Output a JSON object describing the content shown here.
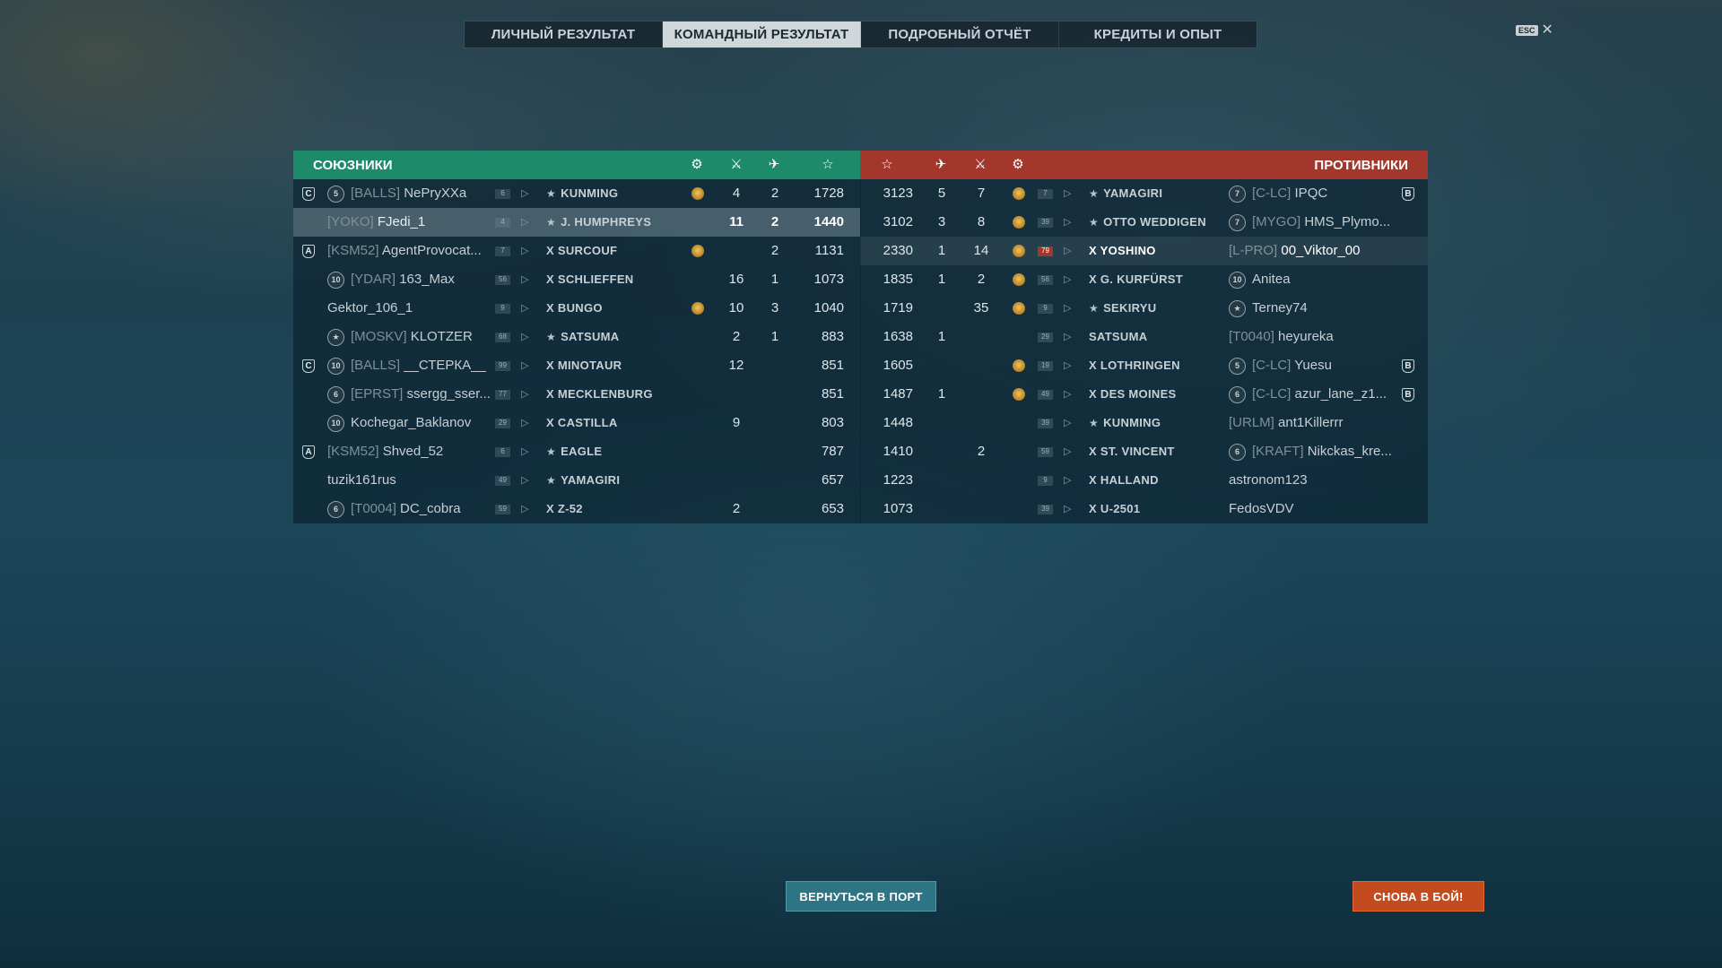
{
  "tabs": [
    {
      "label": "ЛИЧНЫЙ РЕЗУЛЬТАТ",
      "active": false
    },
    {
      "label": "КОМАНДНЫЙ РЕЗУЛЬТАТ",
      "active": true
    },
    {
      "label": "ПОДРОБНЫЙ ОТЧЁТ",
      "active": false
    },
    {
      "label": "КРЕДИТЫ И ОПЫТ",
      "active": false
    }
  ],
  "esc_label": "ESC",
  "close_glyph": "✕",
  "allies": {
    "title": "СОЮЗНИКИ",
    "color": "#1d8a6a",
    "rows": [
      {
        "division": "C",
        "rank": "5",
        "clan": "[BALLS]",
        "name": "NePryXXa",
        "tier": "6",
        "ship_mark": "★",
        "ship": "KUNMING",
        "medal": true,
        "frags": "4",
        "planes": "2",
        "xp": "1728"
      },
      {
        "division": "",
        "rank": "",
        "clan": "[YOKO]",
        "name": "FJedi_1",
        "tier": "4",
        "ship_mark": "★",
        "ship": "J. HUMPHREYS",
        "medal": false,
        "frags": "11",
        "planes": "2",
        "xp": "1440",
        "self": true
      },
      {
        "division": "A",
        "rank": "",
        "clan": "[KSM52]",
        "name": "AgentProvocat...",
        "tier": "7",
        "ship_mark": "",
        "ship": "X SURCOUF",
        "medal": true,
        "frags": "",
        "planes": "2",
        "xp": "1131"
      },
      {
        "division": "",
        "rank": "10",
        "clan": "[YDAR]",
        "name": "163_Max",
        "tier": "56",
        "ship_mark": "",
        "ship": "X SCHLIEFFEN",
        "medal": false,
        "frags": "16",
        "planes": "1",
        "xp": "1073"
      },
      {
        "division": "",
        "rank": "",
        "clan": "",
        "name": "Gektor_106_1",
        "tier": "9",
        "ship_mark": "",
        "ship": "X BUNGO",
        "medal": true,
        "frags": "10",
        "planes": "3",
        "xp": "1040"
      },
      {
        "division": "",
        "rank": "★",
        "clan": "[MOSKV]",
        "name": "KLOTZER",
        "tier": "68",
        "ship_mark": "★",
        "ship": "SATSUMA",
        "medal": false,
        "frags": "2",
        "planes": "1",
        "xp": "883"
      },
      {
        "division": "C",
        "rank": "10",
        "clan": "[BALLS]",
        "name": "__СТЕРКА__",
        "tier": "99",
        "ship_mark": "",
        "ship": "X MINOTAUR",
        "medal": false,
        "frags": "12",
        "planes": "",
        "xp": "851"
      },
      {
        "division": "",
        "rank": "6",
        "clan": "[EPRST]",
        "name": "ssergg_sser...",
        "tier": "77",
        "ship_mark": "",
        "ship": "X MECKLENBURG",
        "medal": false,
        "frags": "",
        "planes": "",
        "xp": "851"
      },
      {
        "division": "",
        "rank": "10",
        "clan": "",
        "name": "Kochegar_Baklanov",
        "tier": "29",
        "ship_mark": "",
        "ship": "X CASTILLA",
        "medal": false,
        "frags": "9",
        "planes": "",
        "xp": "803"
      },
      {
        "division": "A",
        "rank": "",
        "clan": "[KSM52]",
        "name": "Shved_52",
        "tier": "6",
        "ship_mark": "★",
        "ship": "EAGLE",
        "medal": false,
        "frags": "",
        "planes": "",
        "xp": "787"
      },
      {
        "division": "",
        "rank": "",
        "clan": "",
        "name": "tuzik161rus",
        "tier": "49",
        "ship_mark": "★",
        "ship": "YAMAGIRI",
        "medal": false,
        "frags": "",
        "planes": "",
        "xp": "657"
      },
      {
        "division": "",
        "rank": "6",
        "clan": "[T0004]",
        "name": "DC_cobra",
        "tier": "59",
        "ship_mark": "",
        "ship": "X Z-52",
        "medal": false,
        "frags": "2",
        "planes": "",
        "xp": "653"
      }
    ]
  },
  "enemies": {
    "title": "ПРОТИВНИКИ",
    "color": "#a3372b",
    "rows": [
      {
        "xp": "3123",
        "planes": "5",
        "frags": "7",
        "medal": true,
        "tier": "7",
        "ship_mark": "★",
        "ship": "YAMAGIRI",
        "rank": "7",
        "clan": "[C-LC]",
        "name": "IPQC",
        "division": "B"
      },
      {
        "xp": "3102",
        "planes": "3",
        "frags": "8",
        "medal": true,
        "tier": "39",
        "ship_mark": "★",
        "ship": "OTTO WEDDIGEN",
        "rank": "7",
        "clan": "[MYGO]",
        "name": "HMS_Plymo...",
        "division": ""
      },
      {
        "xp": "2330",
        "planes": "1",
        "frags": "14",
        "medal": true,
        "tier": "79",
        "ship_mark": "",
        "ship": "X YOSHINO",
        "rank": "",
        "clan": "[L-PRO]",
        "name": "00_Viktor_00",
        "division": "",
        "highlight": true
      },
      {
        "xp": "1835",
        "planes": "1",
        "frags": "2",
        "medal": true,
        "tier": "56",
        "ship_mark": "",
        "ship": "X G. KURFÜRST",
        "rank": "10",
        "clan": "",
        "name": "Anitea",
        "division": ""
      },
      {
        "xp": "1719",
        "planes": "",
        "frags": "35",
        "medal": true,
        "tier": "9",
        "ship_mark": "★",
        "ship": "SEKIRYU",
        "rank": "★",
        "clan": "",
        "name": "Terney74",
        "division": ""
      },
      {
        "xp": "1638",
        "planes": "1",
        "frags": "",
        "medal": false,
        "tier": "29",
        "ship_mark": "",
        "ship": "SATSUMA",
        "rank": "",
        "clan": "[T0040]",
        "name": "heyureka",
        "division": ""
      },
      {
        "xp": "1605",
        "planes": "",
        "frags": "",
        "medal": true,
        "tier": "19",
        "ship_mark": "",
        "ship": "X LOTHRINGEN",
        "rank": "5",
        "clan": "[C-LC]",
        "name": "Yuesu",
        "division": "B"
      },
      {
        "xp": "1487",
        "planes": "1",
        "frags": "",
        "medal": true,
        "tier": "49",
        "ship_mark": "",
        "ship": "X DES MOINES",
        "rank": "6",
        "clan": "[C-LC]",
        "name": "azur_lane_z1...",
        "division": "B"
      },
      {
        "xp": "1448",
        "planes": "",
        "frags": "",
        "medal": false,
        "tier": "39",
        "ship_mark": "★",
        "ship": "KUNMING",
        "rank": "",
        "clan": "[URLM]",
        "name": "ant1Killerrr",
        "division": ""
      },
      {
        "xp": "1410",
        "planes": "",
        "frags": "2",
        "medal": false,
        "tier": "59",
        "ship_mark": "",
        "ship": "X ST. VINCENT",
        "rank": "6",
        "clan": "[KRAFT]",
        "name": "Nikckas_kre...",
        "division": ""
      },
      {
        "xp": "1223",
        "planes": "",
        "frags": "",
        "medal": false,
        "tier": "9",
        "ship_mark": "",
        "ship": "X HALLAND",
        "rank": "",
        "clan": "",
        "name": "astronom123",
        "division": ""
      },
      {
        "xp": "1073",
        "planes": "",
        "frags": "",
        "medal": false,
        "tier": "39",
        "ship_mark": "",
        "ship": "X U-2501",
        "rank": "",
        "clan": "",
        "name": "FedosVDV",
        "division": ""
      }
    ]
  },
  "buttons": {
    "port": "ВЕРНУТЬСЯ В ПОРТ",
    "battle": "СНОВА В БОЙ!"
  }
}
